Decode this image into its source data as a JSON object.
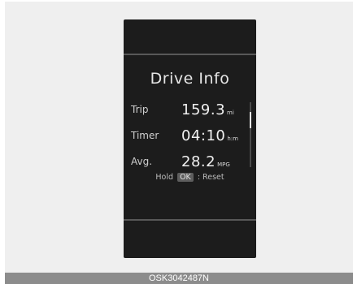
{
  "screen": {
    "title": "Drive Info",
    "rows": [
      {
        "label": "Trip",
        "value": "159.3",
        "unit": "mi"
      },
      {
        "label": "Timer",
        "value": "04:10",
        "unit": "h:m"
      },
      {
        "label": "Avg.",
        "value": "28.2",
        "unit": "MPG"
      }
    ],
    "hint": {
      "prefix": "Hold",
      "key": "OK",
      "suffix": ": Reset"
    }
  },
  "caption": "OSK3042487N",
  "colors": {
    "panel": "#1c1c1c",
    "background": "#efefef",
    "caption_bar": "#8c8c8c"
  },
  "icons": {
    "scrollbar": "scroll-indicator"
  }
}
